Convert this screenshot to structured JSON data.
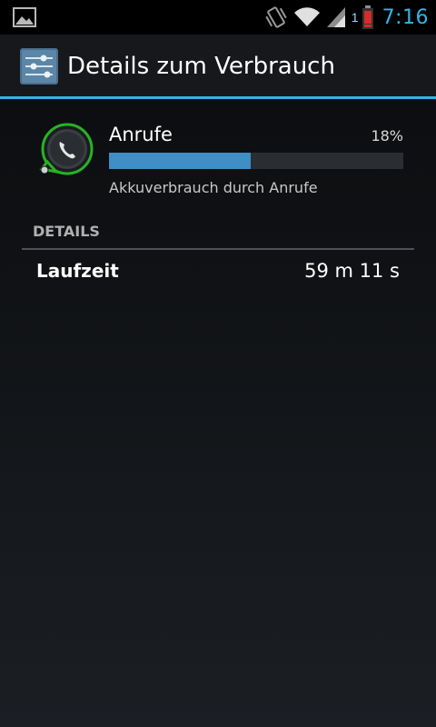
{
  "status_bar": {
    "clock": "7:16",
    "signal_badge": "1",
    "icons": [
      "gallery-icon",
      "vibrate-icon",
      "wifi-icon",
      "cell-signal-icon",
      "battery-low-icon"
    ],
    "clock_color": "#33b5e5"
  },
  "action_bar": {
    "title": "Details zum Verbrauch",
    "icon": "settings-sliders-icon",
    "accent_color": "#33b5e5"
  },
  "usage": {
    "label": "Anrufe",
    "percent_text": "18%",
    "percent_value": 0.48,
    "summary": "Akkuverbrauch durch Anrufe",
    "icon": "phone-icon",
    "bar_color": "#3f8ec5"
  },
  "details": {
    "header": "DETAILS",
    "rows": [
      {
        "key": "Laufzeit",
        "value": "59 m 11 s"
      }
    ]
  }
}
